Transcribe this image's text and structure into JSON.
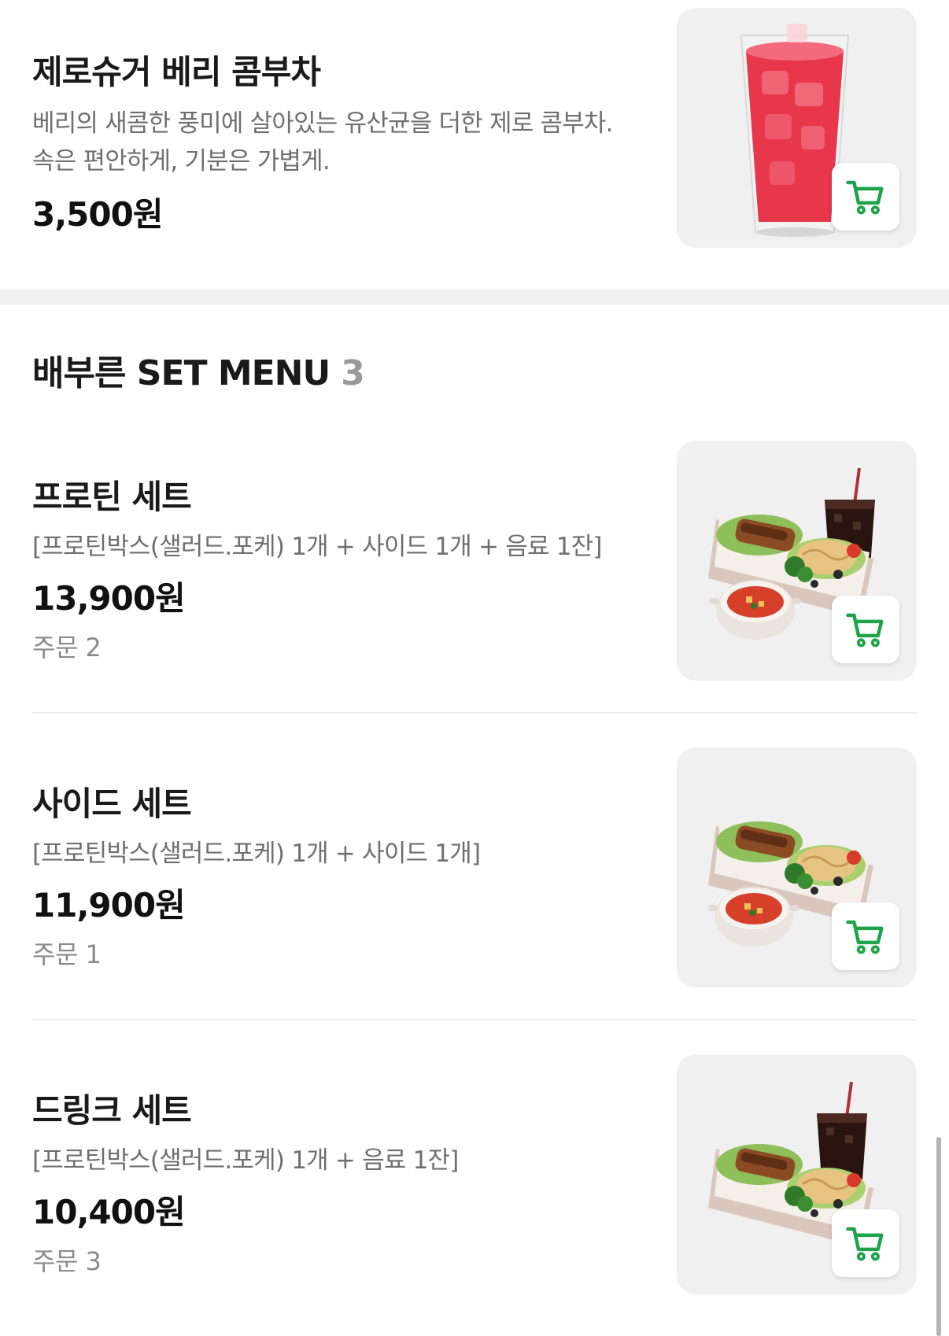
{
  "accent_color": "#1fa34a",
  "top_item": {
    "name": "제로슈거 베리 콤부차",
    "description": "베리의 새콤한 풍미에 살아있는 유산균을 더한 제로 콤부차. 속은 편안하게, 기분은 가볍게.",
    "price": "3,500원",
    "image": "berry-kombucha-drink",
    "cart_icon": "cart-icon"
  },
  "section": {
    "title": "배부른 SET MENU",
    "count": "3"
  },
  "items": [
    {
      "name": "프로틴 세트",
      "description": "[프로틴박스(샐러드.포케) 1개 + 사이드 1개 + 음료 1잔]",
      "price": "13,900원",
      "orders": "주문 2",
      "image": "protein-box-with-soup-and-drink",
      "cart_icon": "cart-icon"
    },
    {
      "name": "사이드 세트",
      "description": "[프로틴박스(샐러드.포케) 1개 + 사이드 1개]",
      "price": "11,900원",
      "orders": "주문 1",
      "image": "protein-box-with-soup",
      "cart_icon": "cart-icon"
    },
    {
      "name": "드링크 세트",
      "description": "[프로틴박스(샐러드.포케) 1개 + 음료 1잔]",
      "price": "10,400원",
      "orders": "주문 3",
      "image": "protein-box-with-drink",
      "cart_icon": "cart-icon"
    }
  ]
}
